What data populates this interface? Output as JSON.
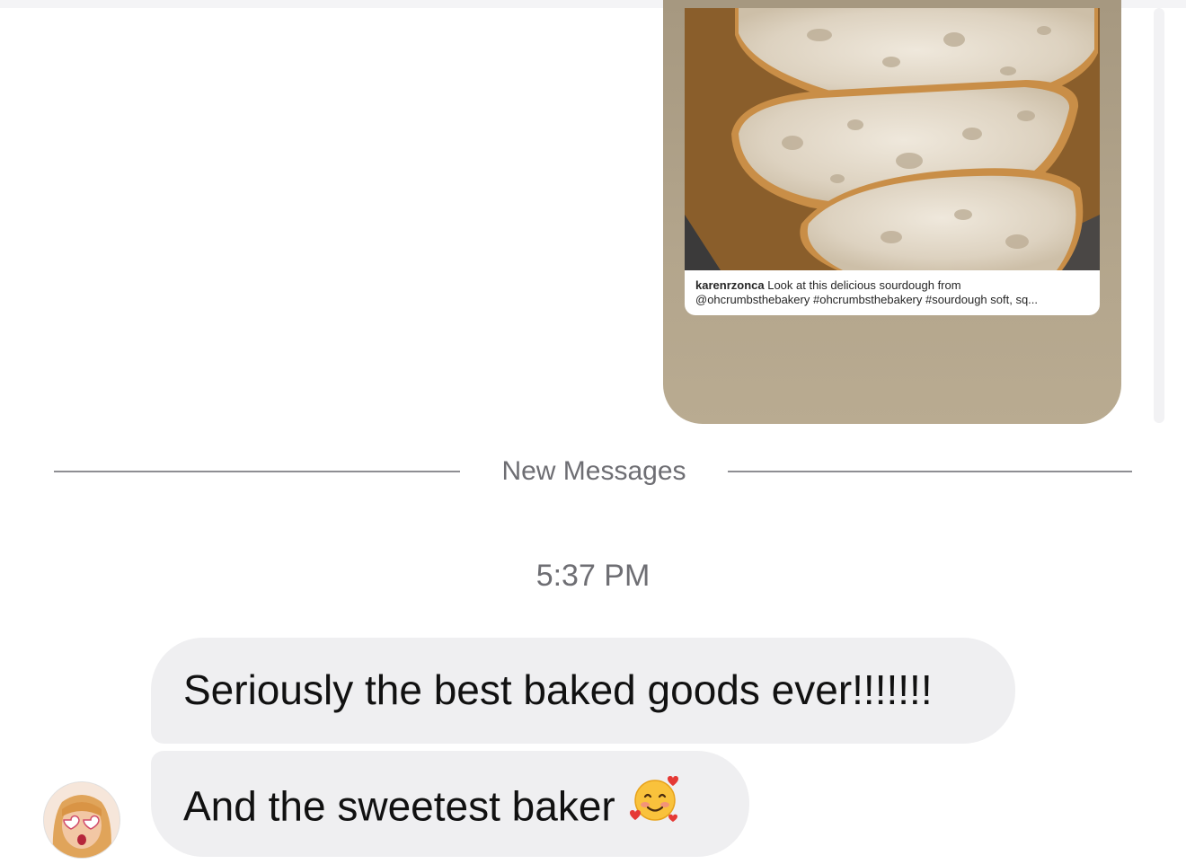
{
  "shared_post": {
    "username": "karenrzonca",
    "caption_line1": "Look at this delicious sourdough from",
    "caption_line2": "@ohcrumbsthebakery #ohcrumbsthebakery #sourdough soft, sq..."
  },
  "divider": {
    "label": "New Messages"
  },
  "conversation": {
    "timestamp": "5:37 PM",
    "messages": [
      {
        "text": "Seriously the best baked goods ever!!!!!!!"
      },
      {
        "text": "And the sweetest baker",
        "emoji": "smiling-face-with-hearts"
      }
    ]
  },
  "colors": {
    "bubble_background": "#efeff1",
    "card_background": "#b3a58c",
    "divider_line": "#8e8e93",
    "meta_text": "#6e6e73"
  }
}
